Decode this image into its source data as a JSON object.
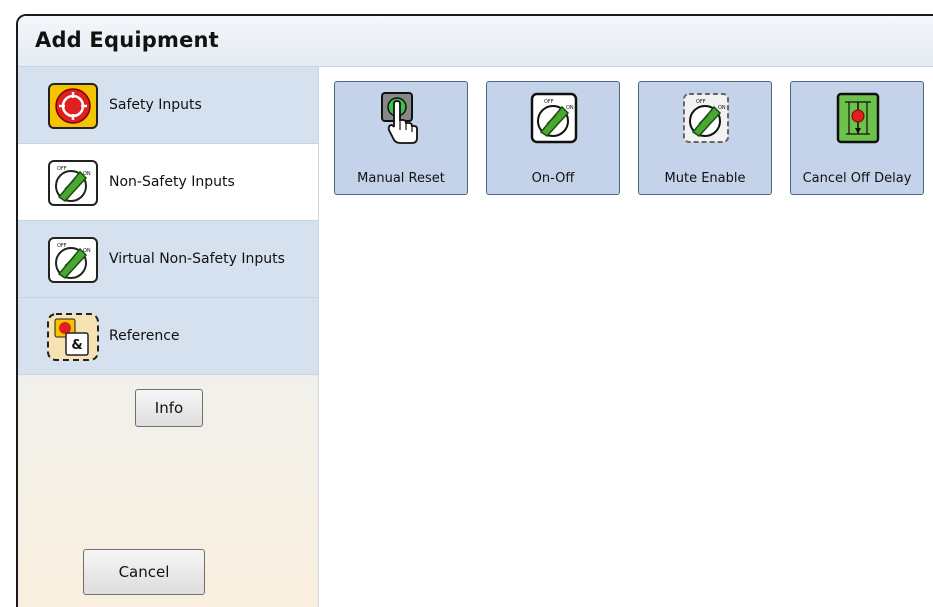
{
  "dialog": {
    "title": "Add Equipment"
  },
  "sidebar": {
    "categories": [
      {
        "label": "Safety Inputs",
        "icon": "emergency-stop-icon",
        "selected": false
      },
      {
        "label": "Non-Safety Inputs",
        "icon": "rotary-switch-icon",
        "selected": true
      },
      {
        "label": "Virtual Non-Safety Inputs",
        "icon": "rotary-switch-icon",
        "selected": false
      },
      {
        "label": "Reference",
        "icon": "reference-icon",
        "selected": false
      }
    ],
    "info_label": "Info",
    "cancel_label": "Cancel"
  },
  "tiles": [
    {
      "label": "Manual Reset",
      "icon": "reset-button-icon"
    },
    {
      "label": "On-Off",
      "icon": "rotary-switch-icon"
    },
    {
      "label": "Mute Enable",
      "icon": "rotary-switch-icon"
    },
    {
      "label": "Cancel Off Delay",
      "icon": "cancel-off-delay-icon"
    }
  ],
  "switch_text": {
    "off": "OFF",
    "on": "ON"
  },
  "reference_glyph": "&",
  "colors": {
    "tile_bg": "#c4d3e9",
    "category_bg": "#d6e1ef",
    "selected_bg": "#ffffff",
    "switch_green": "#4aa832",
    "estop_yellow": "#f5c400",
    "estop_red": "#e02020"
  }
}
